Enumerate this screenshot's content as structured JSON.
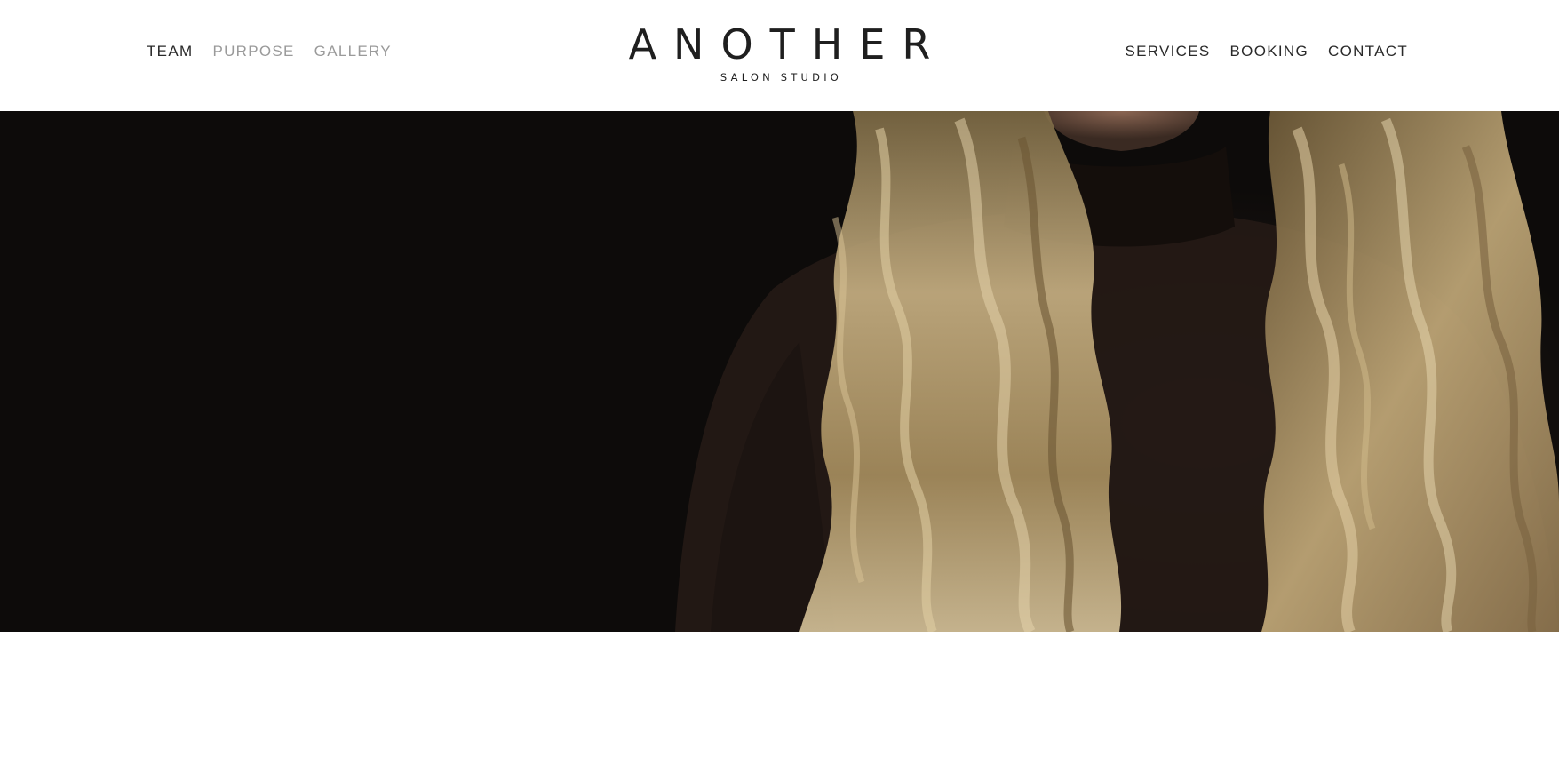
{
  "nav_left": [
    {
      "label": "TEAM",
      "style": "dark"
    },
    {
      "label": "PURPOSE",
      "style": "muted"
    },
    {
      "label": "GALLERY",
      "style": "muted"
    }
  ],
  "nav_right": [
    {
      "label": "SERVICES"
    },
    {
      "label": "BOOKING"
    },
    {
      "label": "CONTACT"
    }
  ],
  "logo": {
    "main": "ANOTHER",
    "sub": "SALON STUDIO"
  },
  "colors": {
    "text_dark": "#2a2a2a",
    "text_muted": "#9a9a9a",
    "hero_background": "#0d0b0a",
    "hair": "#b39a6a"
  }
}
